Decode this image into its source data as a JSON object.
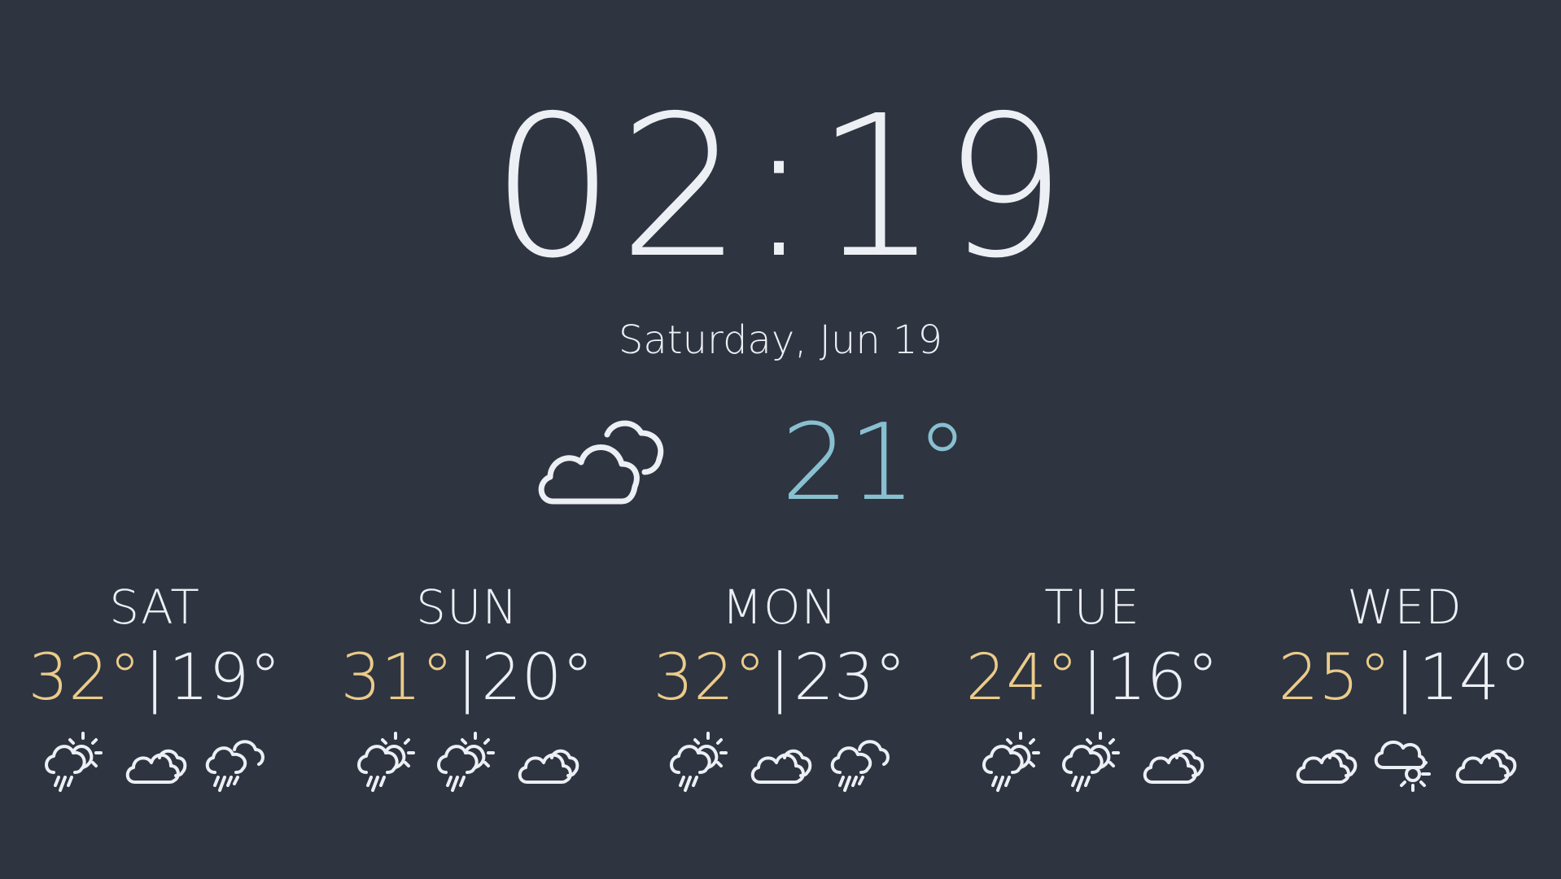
{
  "clock": {
    "time": "02:19"
  },
  "date": {
    "label": "Saturday, Jun 19"
  },
  "current": {
    "icon": "partly-cloudy-icon",
    "temp": "21°"
  },
  "colors": {
    "background": "#2e3440",
    "text": "#eceff4",
    "high": "#ebcb8b",
    "current": "#88c0d0"
  },
  "forecast": [
    {
      "day": "SAT",
      "high": "32°",
      "sep": "|",
      "low": "19°",
      "icons": [
        "thunder-sun-rain-icon",
        "cloudy-icon",
        "rain-cloud-icon"
      ]
    },
    {
      "day": "SUN",
      "high": "31°",
      "sep": "|",
      "low": "20°",
      "icons": [
        "thunder-sun-rain-icon",
        "thunder-sun-rain-icon",
        "cloudy-icon"
      ]
    },
    {
      "day": "MON",
      "high": "32°",
      "sep": "|",
      "low": "23°",
      "icons": [
        "thunder-sun-rain-icon",
        "cloudy-icon",
        "rain-cloud-icon"
      ]
    },
    {
      "day": "TUE",
      "high": "24°",
      "sep": "|",
      "low": "16°",
      "icons": [
        "thunder-sun-rain-icon",
        "thunder-sun-rain-icon",
        "cloudy-icon"
      ]
    },
    {
      "day": "WED",
      "high": "25°",
      "sep": "|",
      "low": "14°",
      "icons": [
        "cloudy-icon",
        "sun-behind-cloud-icon",
        "cloudy-icon"
      ]
    }
  ]
}
